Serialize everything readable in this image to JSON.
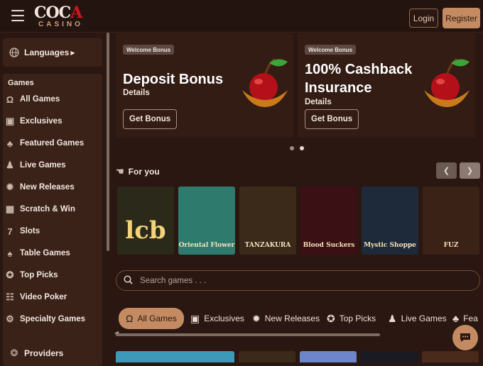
{
  "header": {
    "logo_top_a": "COC",
    "logo_top_b": "A",
    "logo_bottom": "CASINO",
    "login_label": "Login",
    "register_label": "Register"
  },
  "sidebar": {
    "languages_label": "Languages",
    "games_title": "Games",
    "items": [
      {
        "label": "All Games",
        "icon": "horseshoe-icon"
      },
      {
        "label": "Exclusives",
        "icon": "exclusive-icon"
      },
      {
        "label": "Featured Games",
        "icon": "clover-icon"
      },
      {
        "label": "Live Games",
        "icon": "live-dealer-icon"
      },
      {
        "label": "New Releases",
        "icon": "new-icon"
      },
      {
        "label": "Scratch & Win",
        "icon": "scratch-icon"
      },
      {
        "label": "Slots",
        "icon": "seven-icon"
      },
      {
        "label": "Table Games",
        "icon": "cards-icon"
      },
      {
        "label": "Top Picks",
        "icon": "medal-icon"
      },
      {
        "label": "Video Poker",
        "icon": "poker-machine-icon"
      },
      {
        "label": "Specialty Games",
        "icon": "gear-icon"
      }
    ],
    "providers_label": "Providers"
  },
  "banners": [
    {
      "tag": "Welcome Bonus",
      "title_lines": [
        "Deposit Bonus"
      ],
      "details": "Details",
      "button": "Get Bonus"
    },
    {
      "tag": "Welcome Bonus",
      "title_lines": [
        "100% Cashback",
        "Insurance"
      ],
      "details": "Details",
      "button": "Get Bonus"
    }
  ],
  "carousel": {
    "active_index": 1,
    "count": 2
  },
  "for_you": {
    "title": "For you",
    "games": [
      {
        "label": "lcb",
        "color": "#2b2a1a"
      },
      {
        "label": "Oriental Flower",
        "color": "#2e7b6e"
      },
      {
        "label": "TANZAKURA",
        "color": "#3b2a1a"
      },
      {
        "label": "Blood Suckers",
        "color": "#3a1014"
      },
      {
        "label": "Mystic Shoppe",
        "color": "#1e2a3a"
      },
      {
        "label": "FUZ",
        "color": "#3a2216"
      }
    ]
  },
  "search": {
    "placeholder": "Search games . . ."
  },
  "categories": [
    {
      "label": "All Games",
      "icon": "horseshoe-icon",
      "active": true
    },
    {
      "label": "Exclusives",
      "icon": "exclusive-icon",
      "active": false
    },
    {
      "label": "New Releases",
      "icon": "new-icon",
      "active": false
    },
    {
      "label": "Top Picks",
      "icon": "medal-icon",
      "active": false
    },
    {
      "label": "Live Games",
      "icon": "live-dealer-icon",
      "active": false
    },
    {
      "label": "Fea",
      "icon": "clover-icon",
      "active": false
    }
  ],
  "colors": {
    "accent": "#c48b62",
    "background": "#2a1711",
    "panel": "#3a2219"
  }
}
